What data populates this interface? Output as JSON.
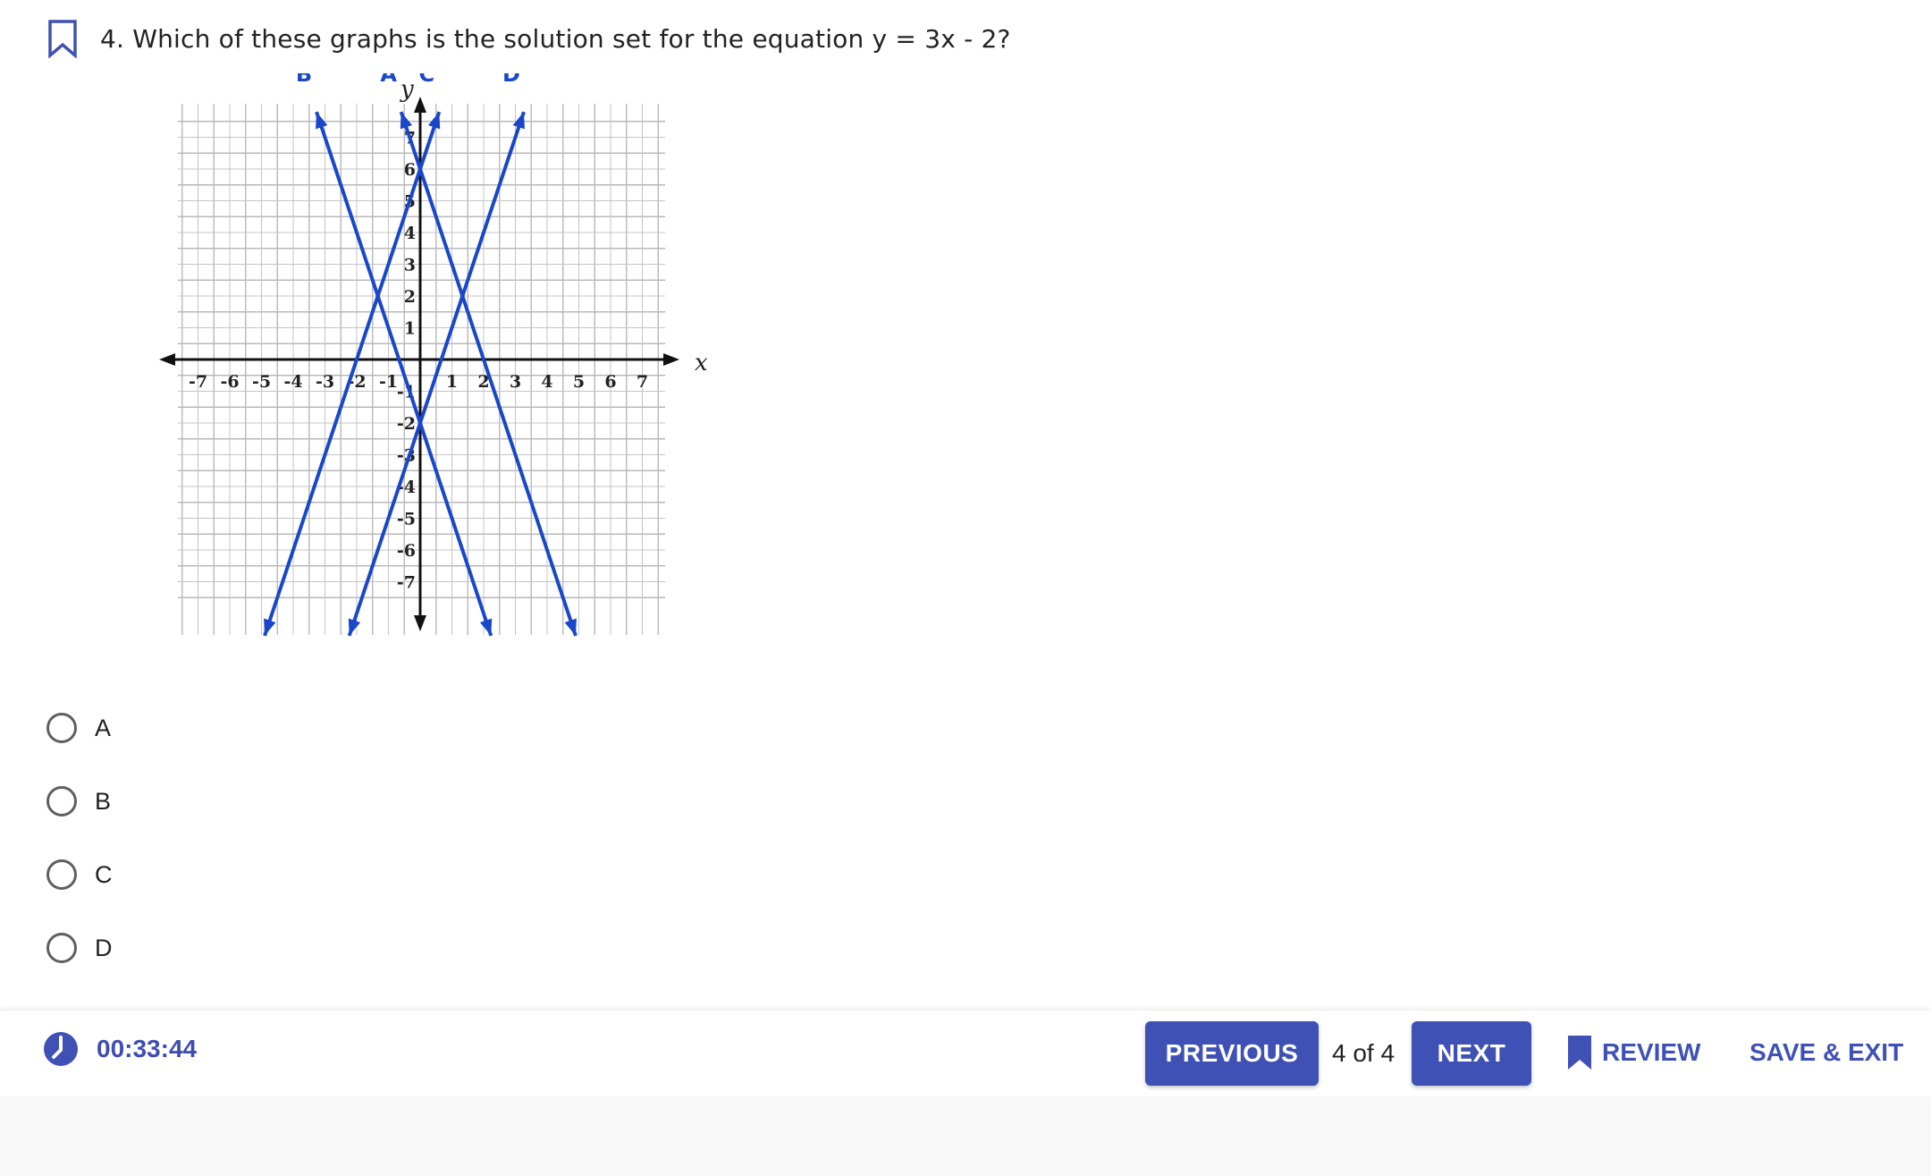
{
  "question": {
    "number_text": "4. Which of these graphs is the solution set for the equation y = 3x - 2?"
  },
  "graph": {
    "x_axis_label": "x",
    "y_axis_label": "y",
    "line_color": "#1a47c9",
    "x_ticks": [
      "-7",
      "-6",
      "-5",
      "-4",
      "-3",
      "-2",
      "-1",
      "1",
      "2",
      "3",
      "4",
      "5",
      "6",
      "7"
    ],
    "y_ticks": [
      "7",
      "6",
      "5",
      "4",
      "3",
      "2",
      "1",
      "-1",
      "-2",
      "-3",
      "-4",
      "-5",
      "-6",
      "-7"
    ],
    "lines": [
      {
        "label": "A",
        "slope": -3,
        "intercept": 6
      },
      {
        "label": "B",
        "slope": -3,
        "intercept": -2
      },
      {
        "label": "C",
        "slope": 3,
        "intercept": 6
      },
      {
        "label": "D",
        "slope": 3,
        "intercept": -2
      }
    ]
  },
  "options": [
    {
      "label": "A"
    },
    {
      "label": "B"
    },
    {
      "label": "C"
    },
    {
      "label": "D"
    }
  ],
  "footer": {
    "timer": "00:33:44",
    "previous_label": "PREVIOUS",
    "page_indicator": "4 of 4",
    "next_label": "NEXT",
    "review_label": "REVIEW",
    "save_exit_label": "SAVE & EXIT"
  },
  "colors": {
    "accent": "#3f51b5",
    "radio_border": "#5f5f5f",
    "timer_text": "#3f4db3"
  },
  "icons": {
    "question_bookmark": "bookmark-outline-icon",
    "timer": "clock-icon",
    "review": "bookmark-filled-icon"
  }
}
